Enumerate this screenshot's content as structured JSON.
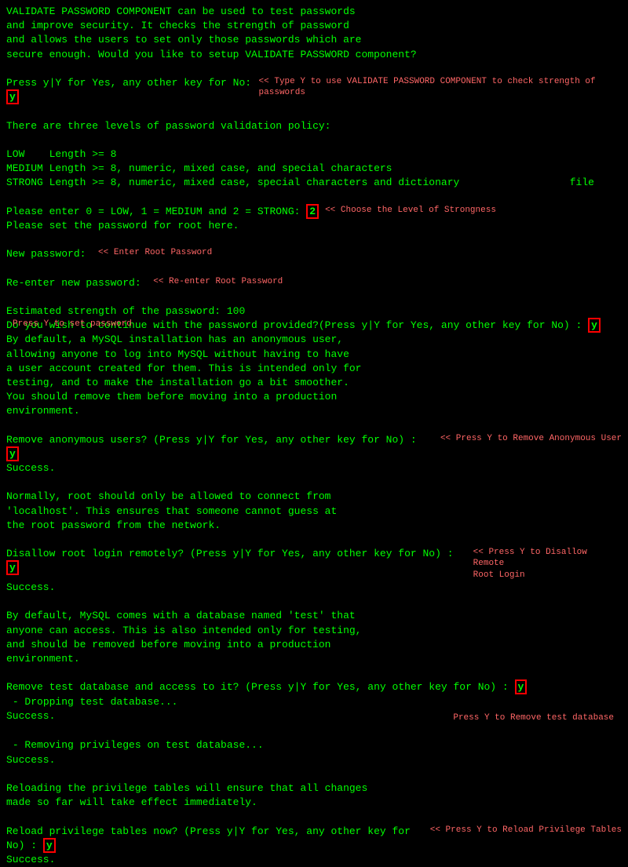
{
  "terminal": {
    "lines": [
      {
        "id": "l1",
        "text": "VALIDATE PASSWORD COMPONENT can be used to test passwords",
        "type": "normal"
      },
      {
        "id": "l2",
        "text": "and improve security. It checks the strength of password",
        "type": "normal"
      },
      {
        "id": "l3",
        "text": "and allows the users to set only those passwords which are",
        "type": "normal"
      },
      {
        "id": "l4",
        "text": "secure enough. Would you like to setup VALIDATE PASSWORD component?",
        "type": "normal"
      },
      {
        "id": "l5",
        "text": "",
        "type": "blank"
      },
      {
        "id": "l6",
        "type": "prompt_y1"
      },
      {
        "id": "l7",
        "text": "",
        "type": "blank"
      },
      {
        "id": "l8",
        "text": "There are three levels of password validation policy:",
        "type": "normal"
      },
      {
        "id": "l9",
        "text": "",
        "type": "blank"
      },
      {
        "id": "l10",
        "text": "LOW    Length >= 8",
        "type": "normal"
      },
      {
        "id": "l11",
        "text": "MEDIUM Length >= 8, numeric, mixed case, and special characters",
        "type": "normal"
      },
      {
        "id": "l12",
        "text": "STRONG Length >= 8, numeric, mixed case, special characters and dictionary                  file",
        "type": "normal"
      },
      {
        "id": "l13",
        "text": "",
        "type": "blank"
      },
      {
        "id": "l14",
        "type": "prompt_2"
      },
      {
        "id": "l15",
        "text": "Please set the password for root here.",
        "type": "normal"
      },
      {
        "id": "l16",
        "text": "",
        "type": "blank"
      },
      {
        "id": "l17",
        "type": "prompt_password1"
      },
      {
        "id": "l18",
        "text": "",
        "type": "blank"
      },
      {
        "id": "l19",
        "type": "prompt_password2"
      },
      {
        "id": "l20",
        "text": "",
        "type": "blank"
      },
      {
        "id": "l21",
        "text": "Estimated strength of the password: 100",
        "type": "normal"
      },
      {
        "id": "l22",
        "type": "prompt_y2"
      },
      {
        "id": "l23",
        "text": "By default, a MySQL installation has an anonymous user,",
        "type": "normal"
      },
      {
        "id": "l24",
        "text": "allowing anyone to log into MySQL without having to have",
        "type": "normal"
      },
      {
        "id": "l25",
        "text": "a user account created for them. This is intended only for",
        "type": "normal"
      },
      {
        "id": "l26",
        "text": "testing, and to make the installation go a bit smoother.",
        "type": "normal"
      },
      {
        "id": "l27",
        "text": "You should remove them before moving into a production",
        "type": "normal"
      },
      {
        "id": "l28",
        "text": "environment.",
        "type": "normal"
      },
      {
        "id": "l29",
        "text": "",
        "type": "blank"
      },
      {
        "id": "l30",
        "type": "prompt_y3"
      },
      {
        "id": "l31",
        "text": "Success.",
        "type": "normal"
      },
      {
        "id": "l32",
        "text": "",
        "type": "blank"
      },
      {
        "id": "l33",
        "text": "Normally, root should only be allowed to connect from",
        "type": "normal"
      },
      {
        "id": "l34",
        "text": "'localhost'. This ensures that someone cannot guess at",
        "type": "normal"
      },
      {
        "id": "l35",
        "text": "the root password from the network.",
        "type": "normal"
      },
      {
        "id": "l36",
        "text": "",
        "type": "blank"
      },
      {
        "id": "l37",
        "type": "prompt_y4"
      },
      {
        "id": "l38",
        "text": "Success.",
        "type": "normal"
      },
      {
        "id": "l39",
        "text": "",
        "type": "blank"
      },
      {
        "id": "l40",
        "text": "By default, MySQL comes with a database named 'test' that",
        "type": "normal"
      },
      {
        "id": "l41",
        "text": "anyone can access. This is also intended only for testing,",
        "type": "normal"
      },
      {
        "id": "l42",
        "text": "and should be removed before moving into a production",
        "type": "normal"
      },
      {
        "id": "l43",
        "text": "environment.",
        "type": "normal"
      },
      {
        "id": "l44",
        "text": "",
        "type": "blank"
      },
      {
        "id": "l45",
        "type": "prompt_y5"
      },
      {
        "id": "l46",
        "text": " - Dropping test database...",
        "type": "normal"
      },
      {
        "id": "l47",
        "text": "Success.",
        "type": "normal"
      },
      {
        "id": "l48",
        "text": "",
        "type": "blank"
      },
      {
        "id": "l49",
        "text": " - Removing privileges on test database...",
        "type": "normal"
      },
      {
        "id": "l50",
        "text": "Success.",
        "type": "normal"
      },
      {
        "id": "l51",
        "text": "",
        "type": "blank"
      },
      {
        "id": "l52",
        "text": "Reloading the privilege tables will ensure that all changes",
        "type": "normal"
      },
      {
        "id": "l53",
        "text": "made so far will take effect immediately.",
        "type": "normal"
      },
      {
        "id": "l54",
        "text": "",
        "type": "blank"
      },
      {
        "id": "l55",
        "type": "prompt_y6"
      },
      {
        "id": "l56",
        "text": "Success.",
        "type": "normal"
      }
    ],
    "annotations": {
      "y1": "Type Y to use VALIDATE PASSWORD COMPONENT\nto check strength of passwords",
      "level": "Choose the Level of Strongness",
      "password1": "Enter Root Password",
      "password2": "Re-enter Root Password",
      "y2_side": "Press Y to set password",
      "y3": "Press Y to Remove Anonymous User",
      "y4_line1": "Press Y to Disallow Remote",
      "y4_line2": "Root Login",
      "y5_side": "Press Y to Remove test database",
      "y6": "Press Y to Reload Privilege"
    }
  }
}
